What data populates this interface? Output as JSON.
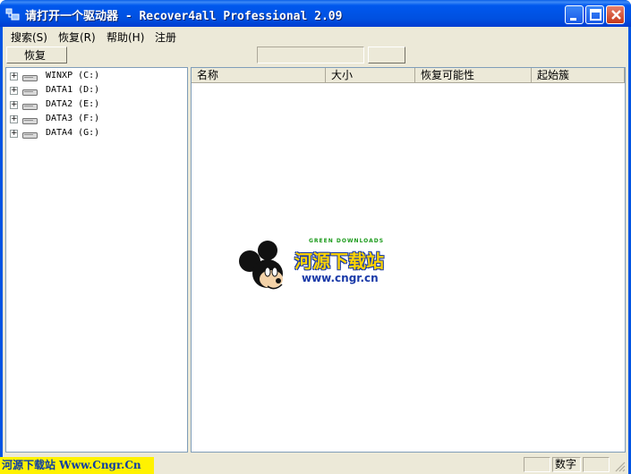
{
  "window": {
    "title": "请打开一个驱动器 - Recover4all Professional 2.09"
  },
  "menu": [
    {
      "label": "搜索(S)"
    },
    {
      "label": "恢复(R)"
    },
    {
      "label": "帮助(H)"
    },
    {
      "label": "注册"
    }
  ],
  "toolbar": {
    "recover_label": "恢复"
  },
  "tree": {
    "drives": [
      {
        "label": "WINXP  (C:)"
      },
      {
        "label": "DATA1  (D:)"
      },
      {
        "label": "DATA2  (E:)"
      },
      {
        "label": "DATA3  (F:)"
      },
      {
        "label": "DATA4  (G:)"
      }
    ]
  },
  "list": {
    "columns": [
      "名称",
      "大小",
      "恢复可能性",
      "起始簇"
    ]
  },
  "watermark": {
    "tagline": "GREEN DOWNLOADS",
    "name": "河源下载站",
    "url": "www.cngr.cn"
  },
  "status": {
    "banner": "河源下载站 Www.Cngr.Cn",
    "num_lock": "数字"
  },
  "colors": {
    "titlebar": "#0054e3",
    "banner_bg": "#fff200",
    "banner_text": "#0a3ca6"
  }
}
